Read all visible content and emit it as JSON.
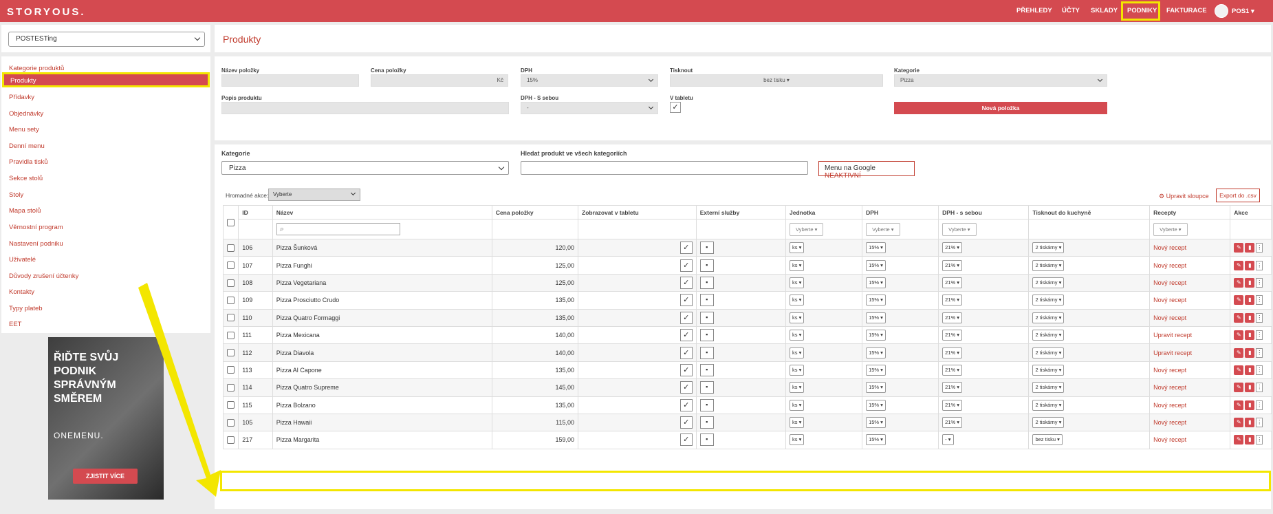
{
  "app": {
    "logo": "STORYOUS.",
    "user": "POS1 ▾"
  },
  "nav": {
    "items": [
      "PŘEHLEDY",
      "ÚČTY",
      "SKLADY",
      "PODNIKY",
      "FAKTURACE"
    ]
  },
  "venue": {
    "selected": "POSTESTing"
  },
  "sidebar": {
    "items": [
      "Kategorie produktů",
      "Produkty",
      "Přídavky",
      "Objednávky",
      "Menu sety",
      "Denní menu",
      "Pravidla tisků",
      "Sekce stolů",
      "Stoly",
      "Mapa stolů",
      "Věrnostní program",
      "Nastavení podniku",
      "Uživatelé",
      "Důvody zrušení účtenky",
      "Kontakty",
      "Typy plateb",
      "EET"
    ],
    "active": "Produkty"
  },
  "ad": {
    "headline": "ŘIĎTE SVŮJ PODNIK SPRÁVNÝM SMĚREM",
    "brand": "ONEMENU.",
    "cta": "ZJISTIT VÍCE"
  },
  "page": {
    "title": "Produkty"
  },
  "form": {
    "name_label": "Název položky",
    "price_label": "Cena položky",
    "currency": "Kč",
    "vat_label": "DPH",
    "vat_value": "15%",
    "print_label": "Tisknout",
    "print_value": "bez tisku ▾",
    "category_label": "Kategorie",
    "category_value": "Pizza",
    "desc_label": "Popis produktu",
    "vat_takeaway_label": "DPH - S sebou",
    "vat_takeaway_value": "-",
    "tablet_label": "V tabletu",
    "new_item_button": "Nová položka"
  },
  "filter": {
    "category_label": "Kategorie",
    "category_value": "Pizza",
    "search_label": "Hledat produkt ve všech kategoriích",
    "google_label": "Menu na Google",
    "google_status": "NEAKTIVNÍ"
  },
  "table": {
    "bulk_label": "Hromadné akce:",
    "bulk_value": "Vyberte",
    "edit_columns": "⚙ Upravit sloupce",
    "export": "Export do .csv",
    "headers": [
      "ID",
      "Název",
      "Cena položky",
      "Zobrazovat v tabletu",
      "Externí služby",
      "Jednotka",
      "DPH",
      "DPH - s sebou",
      "Tisknout do kuchyně",
      "Recepty",
      "Akce"
    ],
    "filter_placeholder": "Vyberte ▾",
    "rows": [
      {
        "id": "106",
        "name": "Pizza Šunková",
        "price": "120,00",
        "unit": "ks ▾",
        "vat": "15% ▾",
        "vat_to": "21% ▾",
        "print": "2 tiskárny ▾",
        "recipe": "Nový recept"
      },
      {
        "id": "107",
        "name": "Pizza Funghi",
        "price": "125,00",
        "unit": "ks ▾",
        "vat": "15% ▾",
        "vat_to": "21% ▾",
        "print": "2 tiskárny ▾",
        "recipe": "Nový recept"
      },
      {
        "id": "108",
        "name": "Pizza Vegetariana",
        "price": "125,00",
        "unit": "ks ▾",
        "vat": "15% ▾",
        "vat_to": "21% ▾",
        "print": "2 tiskárny ▾",
        "recipe": "Nový recept"
      },
      {
        "id": "109",
        "name": "Pizza Prosciutto Crudo",
        "price": "135,00",
        "unit": "ks ▾",
        "vat": "15% ▾",
        "vat_to": "21% ▾",
        "print": "2 tiskárny ▾",
        "recipe": "Nový recept"
      },
      {
        "id": "110",
        "name": "Pizza Quatro Formaggi",
        "price": "135,00",
        "unit": "ks ▾",
        "vat": "15% ▾",
        "vat_to": "21% ▾",
        "print": "2 tiskárny ▾",
        "recipe": "Nový recept"
      },
      {
        "id": "111",
        "name": "Pizza Mexicana",
        "price": "140,00",
        "unit": "ks ▾",
        "vat": "15% ▾",
        "vat_to": "21% ▾",
        "print": "2 tiskárny ▾",
        "recipe": "Upravit recept"
      },
      {
        "id": "112",
        "name": "Pizza Diavola",
        "price": "140,00",
        "unit": "ks ▾",
        "vat": "15% ▾",
        "vat_to": "21% ▾",
        "print": "2 tiskárny ▾",
        "recipe": "Upravit recept"
      },
      {
        "id": "113",
        "name": "Pizza Al Capone",
        "price": "135,00",
        "unit": "ks ▾",
        "vat": "15% ▾",
        "vat_to": "21% ▾",
        "print": "2 tiskárny ▾",
        "recipe": "Nový recept"
      },
      {
        "id": "114",
        "name": "Pizza Quatro Supreme",
        "price": "145,00",
        "unit": "ks ▾",
        "vat": "15% ▾",
        "vat_to": "21% ▾",
        "print": "2 tiskárny ▾",
        "recipe": "Nový recept"
      },
      {
        "id": "115",
        "name": "Pizza Bolzano",
        "price": "135,00",
        "unit": "ks ▾",
        "vat": "15% ▾",
        "vat_to": "21% ▾",
        "print": "2 tiskárny ▾",
        "recipe": "Nový recept"
      },
      {
        "id": "105",
        "name": "Pizza Hawaii",
        "price": "115,00",
        "unit": "ks ▾",
        "vat": "15% ▾",
        "vat_to": "21% ▾",
        "print": "2 tiskárny ▾",
        "recipe": "Nový recept"
      },
      {
        "id": "217",
        "name": "Pizza Margarita",
        "price": "159,00",
        "unit": "ks ▾",
        "vat": "15% ▾",
        "vat_to": "- ▾",
        "print": "bez tisku ▾",
        "recipe": "Nový recept"
      }
    ]
  },
  "colors": {
    "brand": "#d44a50",
    "highlight": "#f3e600",
    "link": "#c0392b"
  }
}
